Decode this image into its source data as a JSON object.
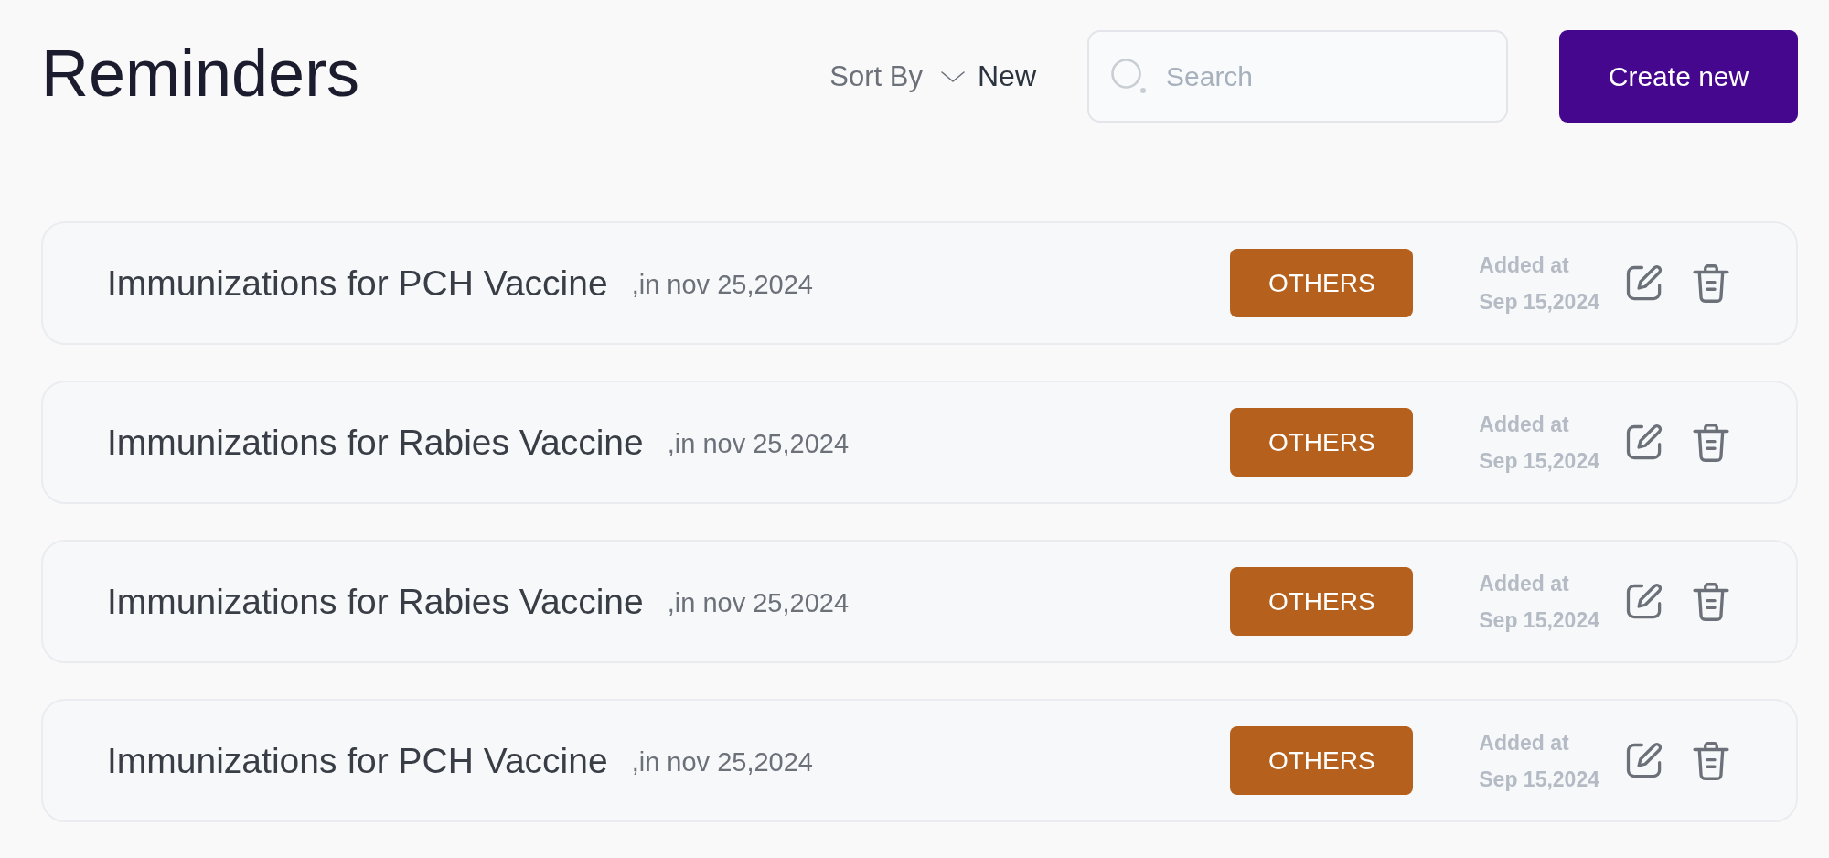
{
  "page": {
    "title": "Reminders"
  },
  "sort": {
    "label": "Sort By",
    "value": "New"
  },
  "search": {
    "placeholder": "Search"
  },
  "create_button": {
    "label": "Create new"
  },
  "reminders": [
    {
      "title": "Immunizations for PCH Vaccine",
      "due": ",in nov 25,2024",
      "category": "OTHERS",
      "added_label": "Added at",
      "added_date": "Sep 15,2024"
    },
    {
      "title": "Immunizations for Rabies Vaccine",
      "due": ",in nov 25,2024",
      "category": "OTHERS",
      "added_label": "Added at",
      "added_date": "Sep 15,2024"
    },
    {
      "title": "Immunizations for Rabies Vaccine",
      "due": ",in nov 25,2024",
      "category": "OTHERS",
      "added_label": "Added at",
      "added_date": "Sep 15,2024"
    },
    {
      "title": "Immunizations for PCH Vaccine",
      "due": ",in nov 25,2024",
      "category": "OTHERS",
      "added_label": "Added at",
      "added_date": "Sep 15,2024"
    }
  ]
}
